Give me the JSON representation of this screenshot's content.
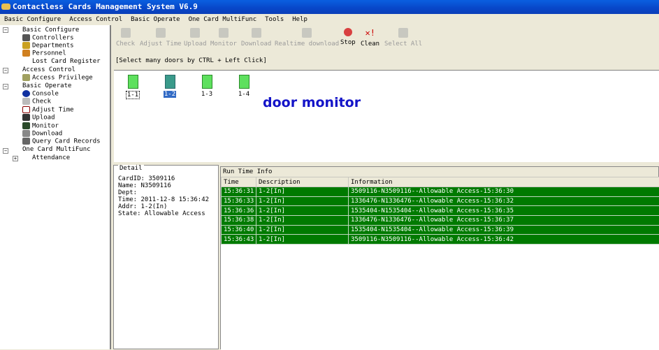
{
  "title": "Contactless Cards Management System   V6.9",
  "menu": [
    "Basic Configure",
    "Access Control",
    "Basic Operate",
    "One Card MultiFunc",
    "Tools",
    "Help"
  ],
  "tree": {
    "basic_configure": "Basic Configure",
    "controllers": "Controllers",
    "departments": "Departments",
    "personnel": "Personnel",
    "lost_card": "Lost Card Register",
    "access_control": "Access Control",
    "access_privilege": "Access Privilege",
    "basic_operate": "Basic Operate",
    "console": "Console",
    "check": "Check",
    "adjust_time": "Adjust Time",
    "upload": "Upload",
    "monitor": "Monitor",
    "download": "Download",
    "query": "Query Card Records",
    "one_card": "One Card MultiFunc",
    "attendance": "Attendance"
  },
  "toolbar": [
    "Check",
    "Adjust Time",
    "Upload",
    "Monitor",
    "Download",
    "Realtime download",
    "Stop",
    "Clean",
    "Select All"
  ],
  "hint": "[Select many doors by CTRL + Left Click]",
  "doors": [
    "1-1",
    "1-2",
    "1-3",
    "1-4"
  ],
  "annotation": "door monitor",
  "detail": {
    "legend": "Detail",
    "card_id": "CardID:  3509116",
    "name": "Name: N3509116",
    "dept": "Dept:",
    "time": "Time: 2011-12-8 15:36:42",
    "addr": "Addr: 1-2(In)",
    "state": "State: Allowable Access"
  },
  "runtime": {
    "title": "Run Time Info",
    "columns": [
      "Time",
      "Description",
      "Information"
    ],
    "rows": [
      [
        "15:36:31",
        "1-2[In]",
        "3509116-N3509116--Allowable Access-15:36:30"
      ],
      [
        "15:36:33",
        "1-2[In]",
        "1336476-N1336476--Allowable Access-15:36:32"
      ],
      [
        "15:36:36",
        "1-2[In]",
        "1535404-N1535404--Allowable Access-15:36:35"
      ],
      [
        "15:36:38",
        "1-2[In]",
        "1336476-N1336476--Allowable Access-15:36:37"
      ],
      [
        "15:36:40",
        "1-2[In]",
        "1535404-N1535404--Allowable Access-15:36:39"
      ],
      [
        "15:36:43",
        "1-2[In]",
        "3509116-N3509116--Allowable Access-15:36:42"
      ]
    ]
  },
  "colors": {
    "row_bg": "#007a00",
    "annotation": "#1414c8",
    "selected": "#316ac5"
  }
}
